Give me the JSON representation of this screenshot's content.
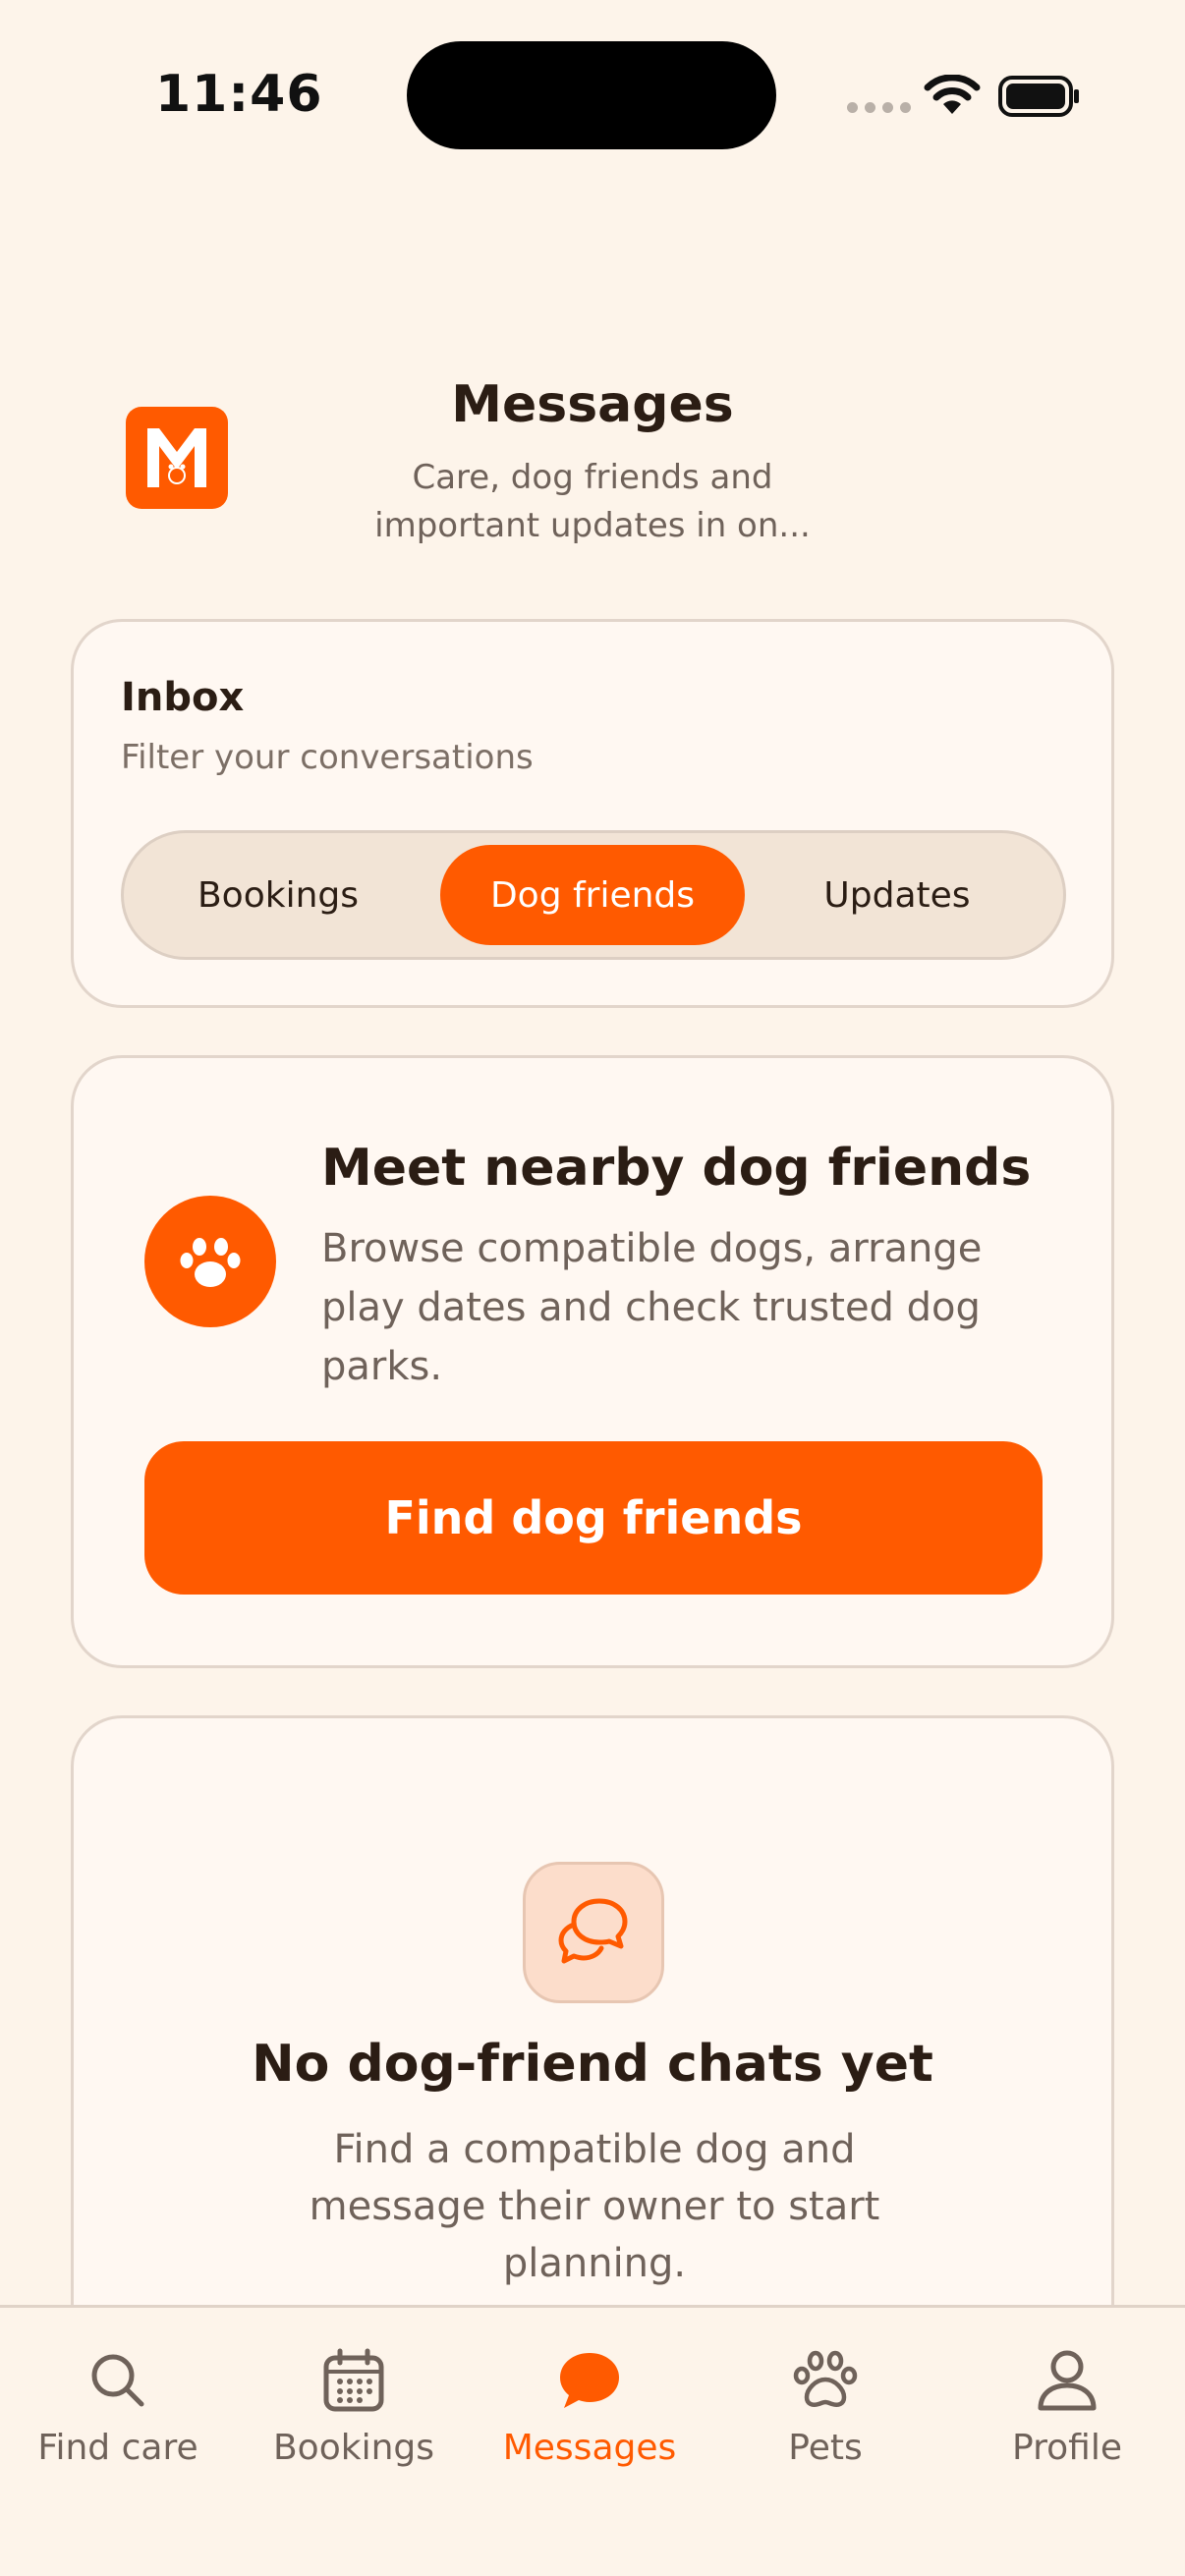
{
  "status_bar": {
    "time": "11:46"
  },
  "header": {
    "title": "Messages",
    "subtitle": "Care, dog friends and important updates in on..."
  },
  "inbox": {
    "title": "Inbox",
    "subtitle": "Filter your conversations",
    "segments": [
      {
        "label": "Bookings",
        "active": false
      },
      {
        "label": "Dog friends",
        "active": true
      },
      {
        "label": "Updates",
        "active": false
      }
    ]
  },
  "dog_friends_card": {
    "title": "Meet nearby dog friends",
    "description": "Browse compatible dogs, arrange play dates and check trusted dog parks.",
    "button_label": "Find dog friends"
  },
  "empty_state": {
    "title": "No dog-friend chats yet",
    "description": "Find a compatible dog and message their owner to start planning."
  },
  "tabbar": {
    "items": [
      {
        "label": "Find care",
        "icon": "search-icon"
      },
      {
        "label": "Bookings",
        "icon": "calendar-icon"
      },
      {
        "label": "Messages",
        "icon": "chat-bubble-icon",
        "active": true
      },
      {
        "label": "Pets",
        "icon": "paw-icon"
      },
      {
        "label": "Profile",
        "icon": "person-icon"
      }
    ]
  },
  "colors": {
    "accent": "#FF5A00",
    "background": "#FDF4EA",
    "card": "#FFF8F2",
    "text": "#2B1D14",
    "muted_text": "#6F625A"
  }
}
